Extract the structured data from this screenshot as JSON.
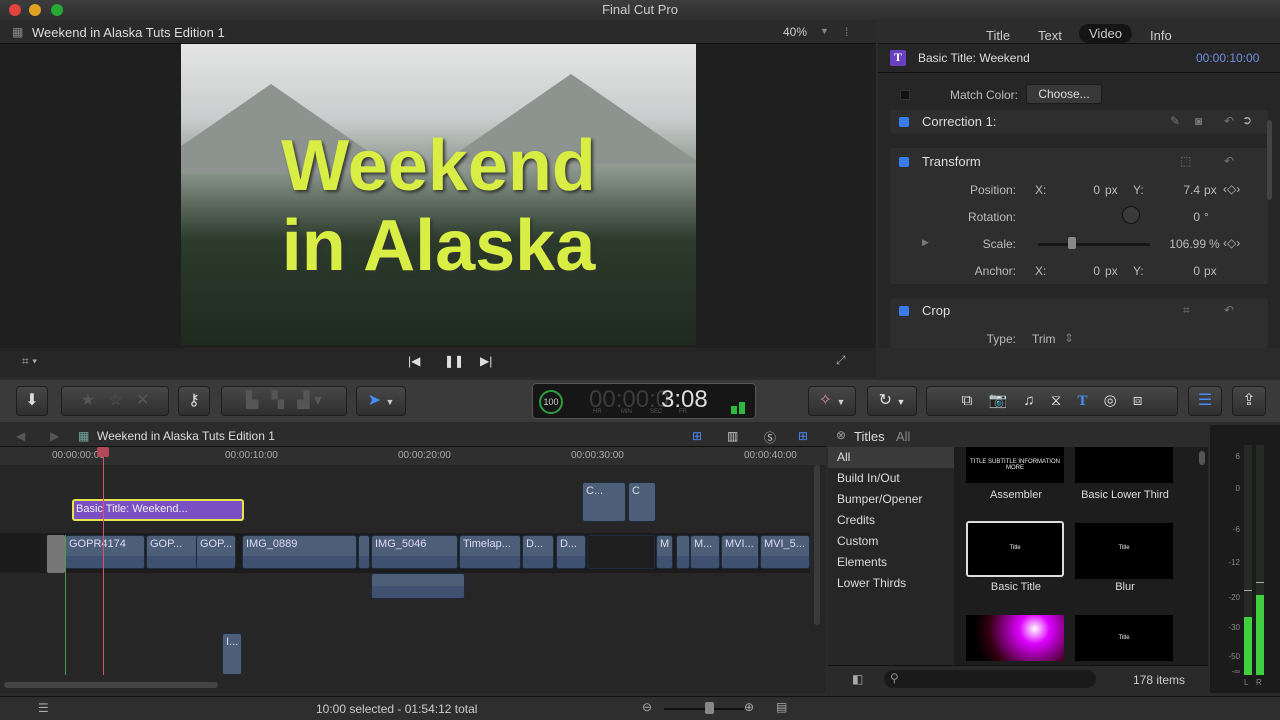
{
  "app": {
    "title": "Final Cut Pro"
  },
  "viewer": {
    "project": "Weekend in Alaska Tuts Edition 1",
    "zoom": "40%",
    "video_title_line1": "Weekend",
    "video_title_line2": "in Alaska"
  },
  "inspector": {
    "tabs": [
      "Title",
      "Text",
      "Video",
      "Info"
    ],
    "active_tab": "Video",
    "clip_name": "Basic Title: Weekend",
    "duration": "00:00:10:00",
    "match_color_label": "Match Color:",
    "choose_label": "Choose...",
    "correction": "Correction 1:",
    "transform": {
      "title": "Transform",
      "position_label": "Position:",
      "x_label": "X:",
      "y_label": "Y:",
      "pos_x": "0",
      "pos_y": "7.4",
      "unit_px": "px",
      "rotation_label": "Rotation:",
      "rotation": "0",
      "deg": "°",
      "scale_label": "Scale:",
      "scale": "106.99",
      "pct": "%",
      "anchor_label": "Anchor:",
      "anchor_x": "0",
      "anchor_y": "0"
    },
    "crop": {
      "title": "Crop",
      "type_label": "Type:",
      "type": "Trim"
    }
  },
  "timecode": {
    "percent": "100",
    "dim": "00:00:0",
    "value": "3:08",
    "units": [
      "HR",
      "MIN",
      "SEC",
      "FR"
    ]
  },
  "timeline": {
    "project": "Weekend in Alaska Tuts Edition 1",
    "ruler": [
      "00:00:00:00",
      "00:00:10:00",
      "00:00:20:00",
      "00:00:30:00",
      "00:00:40:00"
    ],
    "title_clip": "Basic Title: Weekend...",
    "connected": [
      "C...",
      "C"
    ],
    "clips": [
      "GOPR4174",
      "GOP...",
      "GOP...",
      "IMG_0889",
      "",
      "IMG_5046",
      "Timelap...",
      "D...",
      "D...",
      "",
      "M",
      "",
      "M...",
      "MVI...",
      "MVI_5..."
    ],
    "lower_clip": "I..."
  },
  "browser": {
    "header": "Titles",
    "filter": "All",
    "categories": [
      "All",
      "Build In/Out",
      "Bumper/Opener",
      "Credits",
      "Custom",
      "Elements",
      "Lower Thirds"
    ],
    "active_category": "All",
    "items": [
      {
        "name": "Assembler",
        "thumb": "TITLE SUBTITLE INFORMATION MORE"
      },
      {
        "name": "Basic Lower Third",
        "thumb": ""
      },
      {
        "name": "Basic Title",
        "thumb": "Title"
      },
      {
        "name": "Blur",
        "thumb": "Title"
      },
      {
        "name": "",
        "thumb": ""
      },
      {
        "name": "",
        "thumb": "Title"
      }
    ],
    "count": "178 items"
  },
  "meters": {
    "scale": [
      "6",
      "0",
      "-6",
      "-12",
      "-20",
      "-30",
      "-50",
      "-∞"
    ],
    "channels": [
      "L",
      "R"
    ],
    "left_level_db": -26,
    "right_level_db": -19,
    "left_peak_db": -18,
    "right_peak_db": -16
  },
  "status": {
    "selection": "10:00 selected - 01:54:12 total"
  },
  "colors": {
    "accent": "#3b7bf0",
    "title_clip": "#7a4fc4",
    "selection": "#e6e64a",
    "playhead": "#e0506a",
    "clip": "#4c5e78",
    "meter": "#3fcf3f"
  }
}
